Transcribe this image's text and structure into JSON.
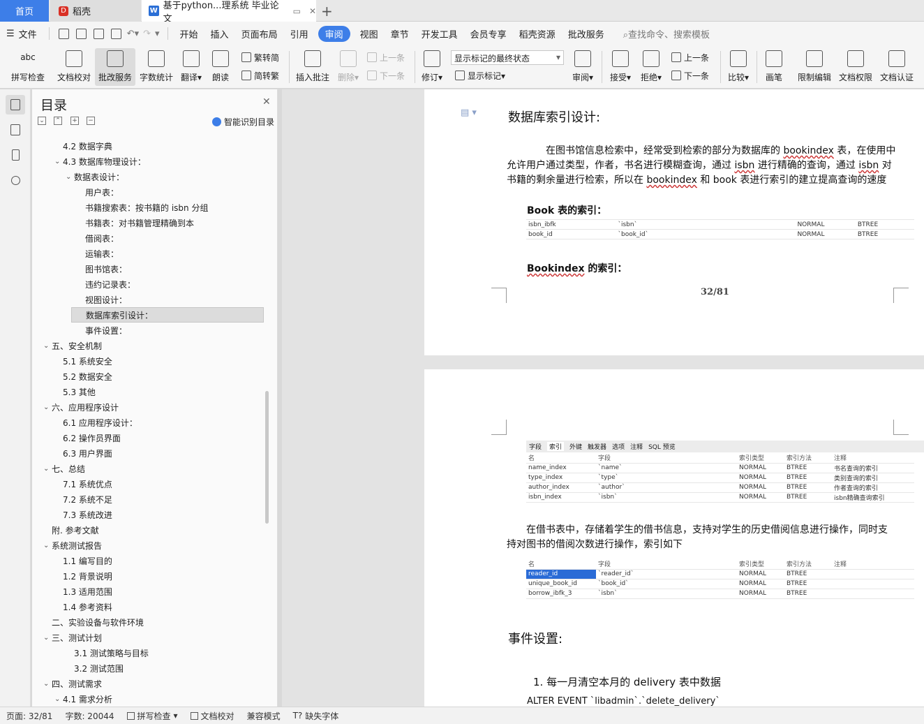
{
  "tabs": {
    "home": "首页",
    "daoke": "稻壳",
    "doc": "基于python...理系统 毕业论文",
    "doc_logo": "W",
    "daoke_logo": "D"
  },
  "menu": {
    "file": "文件",
    "items": [
      "开始",
      "插入",
      "页面布局",
      "引用",
      "审阅",
      "视图",
      "章节",
      "开发工具",
      "会员专享",
      "稻壳资源",
      "批改服务"
    ],
    "active": "审阅",
    "search": "查找命令、搜索模板"
  },
  "ribbon": {
    "spell": "拼写检查",
    "spell_icon_text": "abc",
    "proof": "文档校对",
    "correct": "批改服务",
    "wordcount": "字数统计",
    "translate": "翻译",
    "read": "朗读",
    "to_trad": "繁转简",
    "to_simp": "简转繁",
    "insert_comment": "插入批注",
    "delete": "删除",
    "prev_comment": "上一条",
    "next_comment": "下一条",
    "revise": "修订",
    "markup_state": "显示标记的最终状态",
    "show_markup": "显示标记",
    "review": "审阅",
    "accept": "接受",
    "reject": "拒绝",
    "prev_change": "上一条",
    "next_change": "下一条",
    "compare": "比较",
    "pen": "画笔",
    "restrict": "限制编辑",
    "permission": "文档权限",
    "certify": "文档认证"
  },
  "toc": {
    "title": "目录",
    "smart": "智能识别目录",
    "items": [
      {
        "label": "4.2  数据字典",
        "level": 2,
        "chev": ""
      },
      {
        "label": "4.3 数据库物理设计：",
        "level": 2,
        "chev": "v"
      },
      {
        "label": "数据表设计：",
        "level": 3,
        "chev": "v"
      },
      {
        "label": "用户表：",
        "level": 4,
        "chev": ""
      },
      {
        "label": "书籍搜索表：按书籍的 isbn 分组",
        "level": 4,
        "chev": ""
      },
      {
        "label": "书籍表：对书籍管理精确到本",
        "level": 4,
        "chev": ""
      },
      {
        "label": "借阅表：",
        "level": 4,
        "chev": ""
      },
      {
        "label": "运输表：",
        "level": 4,
        "chev": ""
      },
      {
        "label": "图书馆表：",
        "level": 4,
        "chev": ""
      },
      {
        "label": "违约记录表：",
        "level": 4,
        "chev": ""
      },
      {
        "label": "视图设计：",
        "level": 4,
        "chev": ""
      },
      {
        "label": "数据库索引设计：",
        "level": 4,
        "chev": "",
        "selected": true
      },
      {
        "label": "事件设置：",
        "level": 4,
        "chev": ""
      },
      {
        "label": "五、安全机制",
        "level": 1,
        "chev": "v"
      },
      {
        "label": "5.1  系统安全",
        "level": 2,
        "chev": ""
      },
      {
        "label": "5.2  数据安全",
        "level": 2,
        "chev": ""
      },
      {
        "label": "5.3  其他",
        "level": 2,
        "chev": ""
      },
      {
        "label": "六、应用程序设计",
        "level": 1,
        "chev": "v"
      },
      {
        "label": "6.1 应用程序设计：",
        "level": 2,
        "chev": ""
      },
      {
        "label": "6.2 操作员界面",
        "level": 2,
        "chev": ""
      },
      {
        "label": "6.3 用户界面",
        "level": 2,
        "chev": ""
      },
      {
        "label": "七、总结",
        "level": 1,
        "chev": "v"
      },
      {
        "label": "7.1  系统优点",
        "level": 2,
        "chev": ""
      },
      {
        "label": "7.2  系统不足",
        "level": 2,
        "chev": ""
      },
      {
        "label": "7.3  系统改进",
        "level": 2,
        "chev": ""
      },
      {
        "label": "附. 参考文献",
        "level": 1,
        "chev": ""
      },
      {
        "label": "系统测试报告",
        "level": 1,
        "chev": "v"
      },
      {
        "label": "1.1  编写目的",
        "level": 2,
        "chev": ""
      },
      {
        "label": "1.2  背景说明",
        "level": 2,
        "chev": ""
      },
      {
        "label": "1.3  适用范围",
        "level": 2,
        "chev": ""
      },
      {
        "label": "1.4  参考资料",
        "level": 2,
        "chev": ""
      },
      {
        "label": "二、实验设备与软件环境",
        "level": 1,
        "chev": ""
      },
      {
        "label": "三、测试计划",
        "level": 1,
        "chev": "v"
      },
      {
        "label": "3.1 测试策略与目标",
        "level": 3,
        "chev": ""
      },
      {
        "label": "3.2 测试范围",
        "level": 3,
        "chev": ""
      },
      {
        "label": "四、测试需求",
        "level": 1,
        "chev": "v"
      },
      {
        "label": "4.1  需求分析",
        "level": 2,
        "chev": "v"
      }
    ]
  },
  "page1": {
    "heading": "数据库索引设计:",
    "para_a": "在图书馆信息检索中，经常受到检索的部分为数据库的 ",
    "para_b": "bookindex",
    "para_c": " 表，在使用中允许用户通过类型，作者，书名进行模糊查询，通过 ",
    "para_d": "isbn",
    "para_e": " 进行精确的查询，通过 ",
    "para_f": "isbn",
    "para_g": " 对书籍的剩余量进行检索，所以在 ",
    "para_h": "bookindex",
    "para_i": " 和 book 表进行索引的建立提高查询的速度",
    "book_idx_title": "Book 表的索引：",
    "book_idx_rows": [
      [
        "isbn_ibfk",
        "`isbn`",
        "NORMAL",
        "BTREE"
      ],
      [
        "book_id",
        "`book_id`",
        "NORMAL",
        "BTREE"
      ]
    ],
    "bookindex_title_a": "Bookindex",
    "bookindex_title_b": " 的索引：",
    "page_number": "32/81"
  },
  "page2": {
    "nav_tabs": [
      "字段",
      "索引",
      "外键",
      "触发器",
      "选项",
      "注释",
      "SQL 预览"
    ],
    "nav_active": "索引",
    "idx_header": [
      "名",
      "字段",
      "索引类型",
      "索引方法",
      "注释"
    ],
    "idx_rows": [
      [
        "name_index",
        "`name`",
        "NORMAL",
        "BTREE",
        "书名查询的索引"
      ],
      [
        "type_index",
        "`type`",
        "NORMAL",
        "BTREE",
        "类别查询的索引"
      ],
      [
        "author_index",
        "`author`",
        "NORMAL",
        "BTREE",
        "作者查询的索引"
      ],
      [
        "isbn_index",
        "`isbn`",
        "NORMAL",
        "BTREE",
        "isbn精确查询索引"
      ]
    ],
    "para": "在借书表中，存储着学生的借书信息，支持对学生的历史借阅信息进行操作，同时支持对图书的借阅次数进行操作，索引如下",
    "borrow_header": [
      "名",
      "字段",
      "索引类型",
      "索引方法",
      "注释"
    ],
    "borrow_rows": [
      [
        "reader_id",
        "`reader_id`",
        "NORMAL",
        "BTREE",
        ""
      ],
      [
        "unique_book_id",
        "`book_id`",
        "NORMAL",
        "BTREE",
        ""
      ],
      [
        "borrow_ibfk_3",
        "`isbn`",
        "NORMAL",
        "BTREE",
        ""
      ]
    ],
    "event_heading": "事件设置:",
    "event_item": "1. 每一月清空本月的 delivery 表中数据",
    "sql_line": "ALTER EVENT `libadmin`.`delete_delivery`"
  },
  "status": {
    "page": "页面: 32/81",
    "words": "字数: 20044",
    "spell": "拼写检查",
    "proof": "文档校对",
    "compat": "兼容模式",
    "missing_font": "缺失字体"
  }
}
